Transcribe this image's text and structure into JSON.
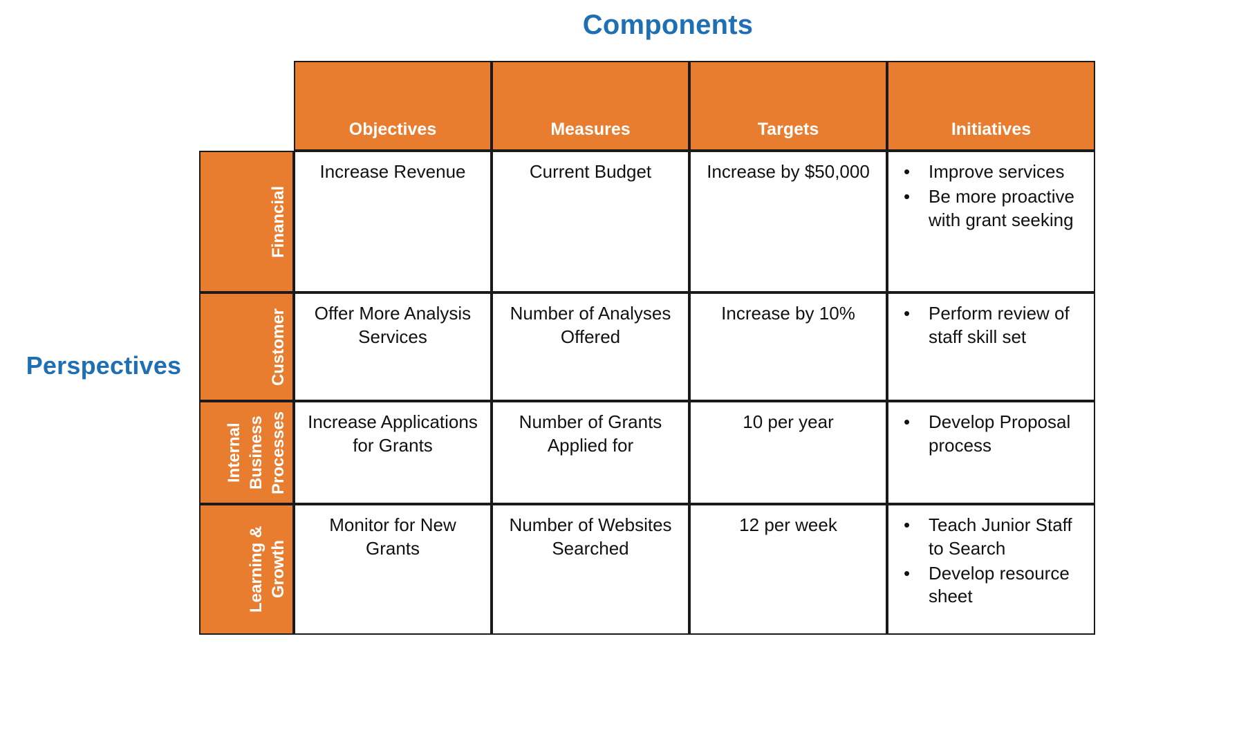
{
  "titles": {
    "components": "Components",
    "perspectives": "Perspectives"
  },
  "colors": {
    "accent_blue": "#1F6FB5",
    "orange": "#E87D2F",
    "border": "#1a1a1a",
    "header_text": "#FFFFFF"
  },
  "chart_data": {
    "type": "table",
    "title": "Components",
    "row_axis_title": "Perspectives",
    "column_headers": [
      "",
      "Objectives",
      "Measures",
      "Targets",
      "Initiatives"
    ],
    "row_headers": [
      "Financial",
      "Customer",
      "Internal Business Processes",
      "Learning & Growth"
    ],
    "rows": [
      {
        "perspective": "Financial",
        "perspective_lines": [
          "Financial"
        ],
        "objectives": "Increase Revenue",
        "measures": "Current Budget",
        "targets": "Increase by $50,000",
        "initiatives": [
          "Improve services",
          "Be more proactive with grant seeking"
        ]
      },
      {
        "perspective": "Customer",
        "perspective_lines": [
          "Customer"
        ],
        "objectives": "Offer More Analysis Services",
        "measures": "Number of Analyses Offered",
        "targets": "Increase by 10%",
        "initiatives": [
          "Perform review of staff skill set"
        ]
      },
      {
        "perspective": "Internal Business Processes",
        "perspective_lines": [
          "Internal",
          "Business",
          "Processes"
        ],
        "objectives": "Increase Applications for Grants",
        "measures": "Number of Grants Applied for",
        "targets": "10 per year",
        "initiatives": [
          "Develop Proposal process"
        ]
      },
      {
        "perspective": "Learning & Growth",
        "perspective_lines": [
          "Learning &",
          "Growth"
        ],
        "objectives": "Monitor for New Grants",
        "measures": "Number of Websites Searched",
        "targets": "12 per week",
        "initiatives": [
          "Teach Junior Staff to Search",
          "Develop resource sheet"
        ]
      }
    ]
  },
  "bullet_glyph": "•"
}
